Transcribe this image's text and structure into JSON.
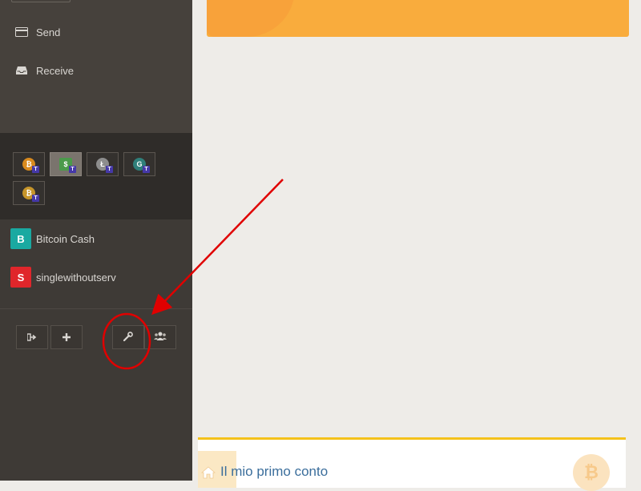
{
  "sidebar": {
    "nav": [
      {
        "label": "Send",
        "icon": "credit-card-icon"
      },
      {
        "label": "Receive",
        "icon": "inbox-icon"
      }
    ],
    "wallets": [
      {
        "icon": "bitcoin-testnet-icon",
        "color": "#d98a1e",
        "letter": "₿",
        "tag": "T"
      },
      {
        "icon": "banknote-testnet-icon",
        "color": "#4b9a4b",
        "letter": "$",
        "tag": "T"
      },
      {
        "icon": "litecoin-testnet-icon",
        "color": "#8d8d8d",
        "letter": "Ł",
        "tag": "T"
      },
      {
        "icon": "globe-testnet-icon",
        "color": "#2f7f7a",
        "letter": "G",
        "tag": "T"
      },
      {
        "icon": "bitcoin-gold-testnet-icon",
        "color": "#c6952a",
        "letter": "₿",
        "tag": "T"
      }
    ],
    "accounts": [
      {
        "badge": "B",
        "label": "Bitcoin Cash",
        "color": "#1aa9a1"
      },
      {
        "badge": "S",
        "label": "singlewithoutserv",
        "color": "#e0262b"
      }
    ],
    "tools": [
      {
        "icon": "sign-out-icon"
      },
      {
        "icon": "plus-icon"
      },
      {
        "icon": "wrench-icon"
      },
      {
        "icon": "users-icon"
      }
    ]
  },
  "main": {
    "banner_color": "#f9ac3d",
    "panel": {
      "title": "Il mio primo conto",
      "accent": "#f4c21b"
    }
  },
  "annotation": {
    "color": "#e00000"
  }
}
